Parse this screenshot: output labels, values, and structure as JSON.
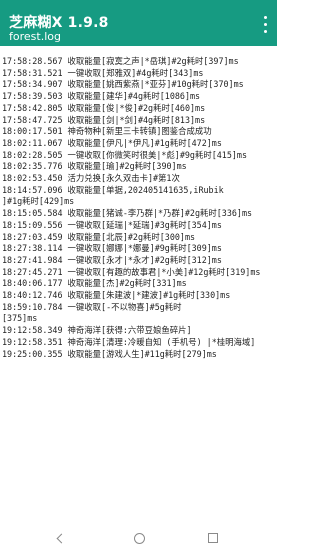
{
  "appbar": {
    "title": "芝麻糊X 1.9.8",
    "subtitle": "forest.log",
    "menu_icon": "more-vert-icon",
    "color": "#169b82"
  },
  "log": {
    "lines": [
      "17:58:28.567 收取能量[寂寞之声|*岳琪]#2g耗时[397]ms",
      "17:58:31.521 一键收取[郑雅双]#4g耗时[343]ms",
      "17:58:34.907 收取能量[姚西紫燕|*亚芬]#10g耗时[370]ms",
      "17:58:39.503 收取能量[建华]#4g耗时[1086]ms",
      "17:58:42.805 收取能量[俊|*俊]#2g耗时[460]ms",
      "17:58:47.725 收取能量[剑|*剑]#4g耗时[813]ms",
      "18:00:17.501 神奇物种[新里三卡转镇]图鉴合成成功",
      "18:02:11.067 收取能量[伊凡|*伊凡]#1g耗时[472]ms",
      "18:02:28.505 一键收取[你微笑时很美|*彪]#9g耗时[415]ms",
      "18:02:35.776 收取能量[瑜]#2g耗时[390]ms",
      "18:02:53.450 活力兑换[永久双击卡]#第1次",
      "18:14:57.096 收取能量[单据,202405141635,iRubik",
      "]#1g耗时[429]ms",
      "18:15:05.584 收取能量[猪诚-李乃群|*乃群]#2g耗时[336]ms",
      "18:15:09.556 一键收取[延瑞|*延瑞]#3g耗时[354]ms",
      "18:27:03.459 收取能量[北辰]#2g耗时[300]ms",
      "18:27:38.114 一键收取[娜娜|*娜曼]#9g耗时[309]ms",
      "18:27:41.984 一键收取[永才|*永才]#2g耗时[312]ms",
      "18:27:45.271 一键收取[有趣的故事君|*小美]#12g耗时[319]ms",
      "18:40:06.177 收取能量[杰]#2g耗时[331]ms",
      "18:40:12.746 收取能量[朱建波|*建波]#1g耗时[330]ms",
      "18:59:10.784 一键收取[-不以物喜]#5g耗时",
      "[375]ms",
      "19:12:58.349 神奇海洋[获得:六带豆娘鱼碎片]",
      "19:12:58.351 神奇海洋[清理:冷暖自知 (手机号) |*桂明海域]",
      "19:25:00.355 收取能量[游戏人生]#11g耗时[279]ms"
    ]
  },
  "navbar": {
    "back_icon": "back-icon",
    "home_icon": "home-icon",
    "recent_icon": "recent-apps-icon"
  }
}
